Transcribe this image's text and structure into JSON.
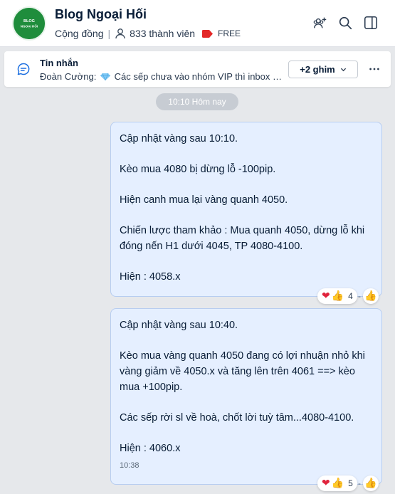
{
  "header": {
    "title": "Blog Ngoại Hối",
    "community_label": "Cộng đồng",
    "members_label": "833 thành viên",
    "free_label": "FREE",
    "avatar_lines": [
      "BLOG",
      "NGOẠI HỐI"
    ],
    "icons": [
      "add-member-icon",
      "search-icon",
      "sidebar-toggle-icon"
    ],
    "accent_color": "#1f8d3c"
  },
  "pinned": {
    "title": "Tin nhắn",
    "sender": "Đoàn Cường:",
    "text": "Các sếp chưa vào nhóm VIP thì inbox za...",
    "pins_button": "+2 ghim",
    "more_icon": "more-dots-icon"
  },
  "date_separator": "10:10 Hôm nay",
  "messages": [
    {
      "paragraphs": [
        "Cập nhật vàng sau 10:10.",
        "Kèo mua 4080 bị dừng lỗ -100pip.",
        "Hiện canh mua lại vàng quanh 4050.",
        "Chiến lược tham khảo : Mua quanh 4050, dừng lỗ khi đóng nến H1 dưới 4045, TP 4080-4100.",
        "Hiện : 4058.x"
      ],
      "time": "",
      "reactions": {
        "icons": [
          "heart-icon",
          "thumbs-up-icon"
        ],
        "count": "4",
        "separator": "-"
      }
    },
    {
      "paragraphs": [
        "Cập nhật vàng sau 10:40.",
        "Kèo mua vàng quanh 4050 đang có lợi nhuận nhỏ khi vàng giảm về 4050.x và tăng lên trên 4061 ==> kèo mua +100pip.",
        "Các sếp rời sl về hoà, chốt lời tuỳ tâm...4080-4100.",
        "Hiện : 4060.x"
      ],
      "time": "10:38",
      "reactions": {
        "icons": [
          "heart-icon",
          "thumbs-up-icon"
        ],
        "count": "5",
        "separator": "-"
      }
    }
  ]
}
